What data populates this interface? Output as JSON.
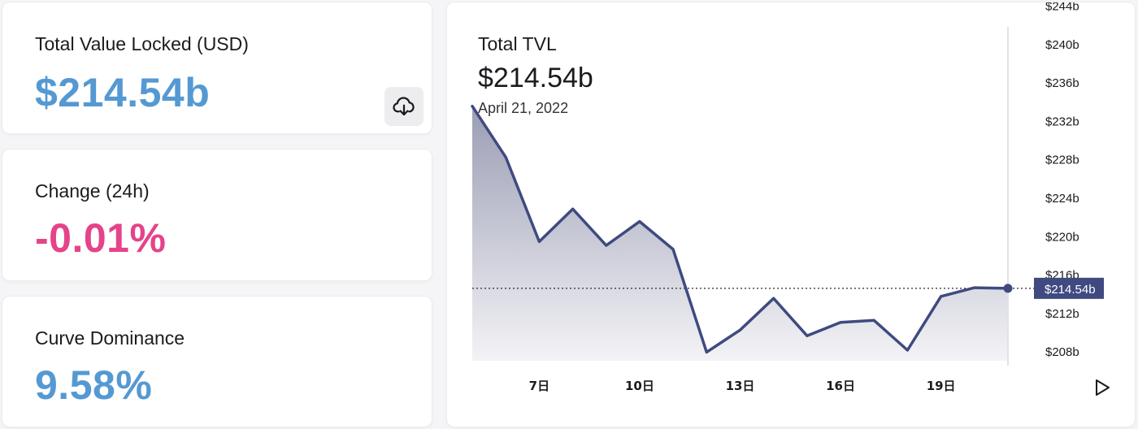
{
  "stats": {
    "tvl": {
      "label": "Total Value Locked (USD)",
      "value": "$214.54b",
      "color": "#5599d3"
    },
    "change": {
      "label": "Change (24h)",
      "value": "-0.01%",
      "color": "#e5438a"
    },
    "dominance": {
      "label": "Curve Dominance",
      "value": "9.58%",
      "color": "#5599d3"
    }
  },
  "download_button": {
    "icon": "cloud-download-icon"
  },
  "chart_panel": {
    "title": "Total TVL",
    "value": "$214.54b",
    "date": "April 21, 2022",
    "play_icon": "play-icon"
  },
  "chart_data": {
    "type": "area",
    "title": "Total TVL",
    "xlabel": "",
    "ylabel": "",
    "x": [
      5,
      6,
      7,
      8,
      9,
      10,
      11,
      12,
      13,
      14,
      15,
      16,
      17,
      18,
      19,
      20,
      21
    ],
    "values": [
      233.5,
      228.2,
      219.4,
      222.8,
      219.0,
      221.5,
      218.6,
      207.9,
      210.2,
      213.5,
      209.6,
      211.0,
      211.2,
      208.1,
      213.7,
      214.6,
      214.54
    ],
    "x_ticks": [
      7,
      10,
      13,
      16,
      19
    ],
    "x_tick_labels": [
      "7日",
      "10日",
      "13日",
      "16日",
      "19日"
    ],
    "y_ticks": [
      208,
      212,
      216,
      220,
      224,
      228,
      232,
      236,
      240,
      244
    ],
    "y_tick_labels": [
      "$208b",
      "$212b",
      "$216b",
      "$220b",
      "$224b",
      "$228b",
      "$232b",
      "$236b",
      "$240b",
      "$244b"
    ],
    "ylim": [
      207,
      244.3
    ],
    "xlim": [
      5,
      21
    ],
    "current_value": 214.54,
    "current_label": "$214.54b",
    "line_color": "#3f4a80",
    "fill_color": "#9b9db4",
    "grid": false
  }
}
